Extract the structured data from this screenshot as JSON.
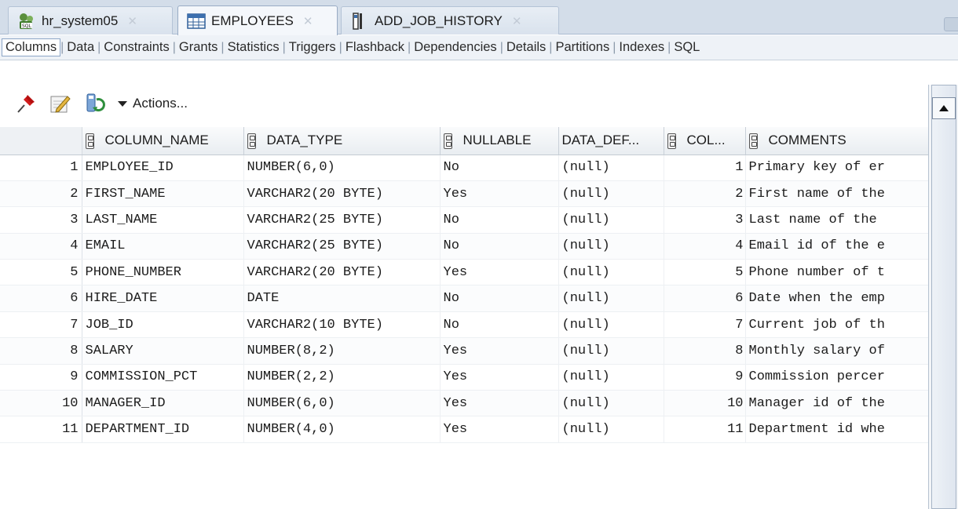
{
  "tabs": [
    {
      "label": "hr_system05",
      "icon": "sql-connection-icon"
    },
    {
      "label": "EMPLOYEES",
      "icon": "table-icon"
    },
    {
      "label": "ADD_JOB_HISTORY",
      "icon": "procedure-icon"
    }
  ],
  "subtabs": [
    "Columns",
    "Data",
    "Constraints",
    "Grants",
    "Statistics",
    "Triggers",
    "Flashback",
    "Dependencies",
    "Details",
    "Partitions",
    "Indexes",
    "SQL"
  ],
  "toolbar": {
    "actions_label": "Actions..."
  },
  "grid": {
    "headers": [
      "COLUMN_NAME",
      "DATA_TYPE",
      "NULLABLE",
      "DATA_DEF...",
      "COL...",
      "COMMENTS"
    ],
    "rows": [
      [
        "1",
        "EMPLOYEE_ID",
        "NUMBER(6,0)",
        "No",
        "(null)",
        "1",
        "Primary key of er"
      ],
      [
        "2",
        "FIRST_NAME",
        "VARCHAR2(20 BYTE)",
        "Yes",
        "(null)",
        "2",
        "First name of the"
      ],
      [
        "3",
        "LAST_NAME",
        "VARCHAR2(25 BYTE)",
        "No",
        "(null)",
        "3",
        "Last name of the"
      ],
      [
        "4",
        "EMAIL",
        "VARCHAR2(25 BYTE)",
        "No",
        "(null)",
        "4",
        "Email id of the e"
      ],
      [
        "5",
        "PHONE_NUMBER",
        "VARCHAR2(20 BYTE)",
        "Yes",
        "(null)",
        "5",
        "Phone number of t"
      ],
      [
        "6",
        "HIRE_DATE",
        "DATE",
        "No",
        "(null)",
        "6",
        "Date when the emp"
      ],
      [
        "7",
        "JOB_ID",
        "VARCHAR2(10 BYTE)",
        "No",
        "(null)",
        "7",
        "Current job of th"
      ],
      [
        "8",
        "SALARY",
        "NUMBER(8,2)",
        "Yes",
        "(null)",
        "8",
        "Monthly salary of"
      ],
      [
        "9",
        "COMMISSION_PCT",
        "NUMBER(2,2)",
        "Yes",
        "(null)",
        "9",
        "Commission percer"
      ],
      [
        "10",
        "MANAGER_ID",
        "NUMBER(6,0)",
        "Yes",
        "(null)",
        "10",
        "Manager id of the"
      ],
      [
        "11",
        "DEPARTMENT_ID",
        "NUMBER(4,0)",
        "Yes",
        "(null)",
        "11",
        "Department id whe"
      ]
    ]
  },
  "colors": {
    "accent": "#8da6c7",
    "tabbar": "#d3dde9"
  }
}
